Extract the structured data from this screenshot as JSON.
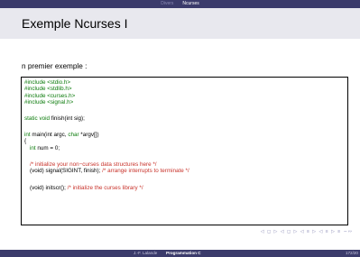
{
  "headline": {
    "section1": "Divers",
    "section2": "Ncurses"
  },
  "frame": {
    "title": "Exemple Ncurses I"
  },
  "intro": "n premier exemple :",
  "code": {
    "inc1": "#include <stdio.h>",
    "inc2": "#include <stdlib.h>",
    "inc3": "#include <curses.h>",
    "inc4": "#include <signal.h>",
    "l6_kw": "static void",
    "l6_rest": " finish(int sig);",
    "l8_kw": "int",
    "l8_mid": " main(int argc, ",
    "l8_kw2": "char",
    "l8_rest": " *argv[])",
    "l9": "{",
    "l10_kw": "int",
    "l10_rest": " num = 0;",
    "l12_comment": "/* initialize your non−curses data structures here */",
    "l13_code": "(void) signal(SIGINT, finish); ",
    "l13_comment": "/* arrange interrupts to terminate */",
    "l15_code": "(void) initscr(); ",
    "l15_comment": "/* initialize the curses library */"
  },
  "nav": {
    "symbols": "◁ ◻ ▷ ◁ ◻ ▷ ◁ ≡ ▷ ◁ ≡ ▷ ≡ ∽∾"
  },
  "footer": {
    "author": "J.-F. Lalande",
    "title": "Programmation C",
    "page": "172/20"
  }
}
